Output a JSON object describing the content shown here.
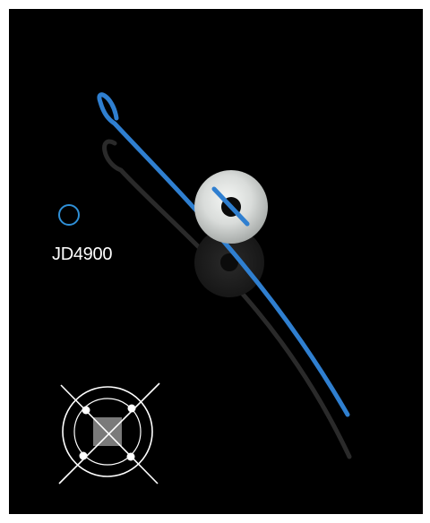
{
  "product": {
    "code": "JD4900",
    "color_swatch": "#2f8fd6",
    "suture_color": "#2f7fd0",
    "bead_color": "#dfe2e0",
    "background": "#000000"
  },
  "icons": {
    "color_indicator": "ring-icon",
    "placement": "crossed-square-in-rings-icon"
  }
}
